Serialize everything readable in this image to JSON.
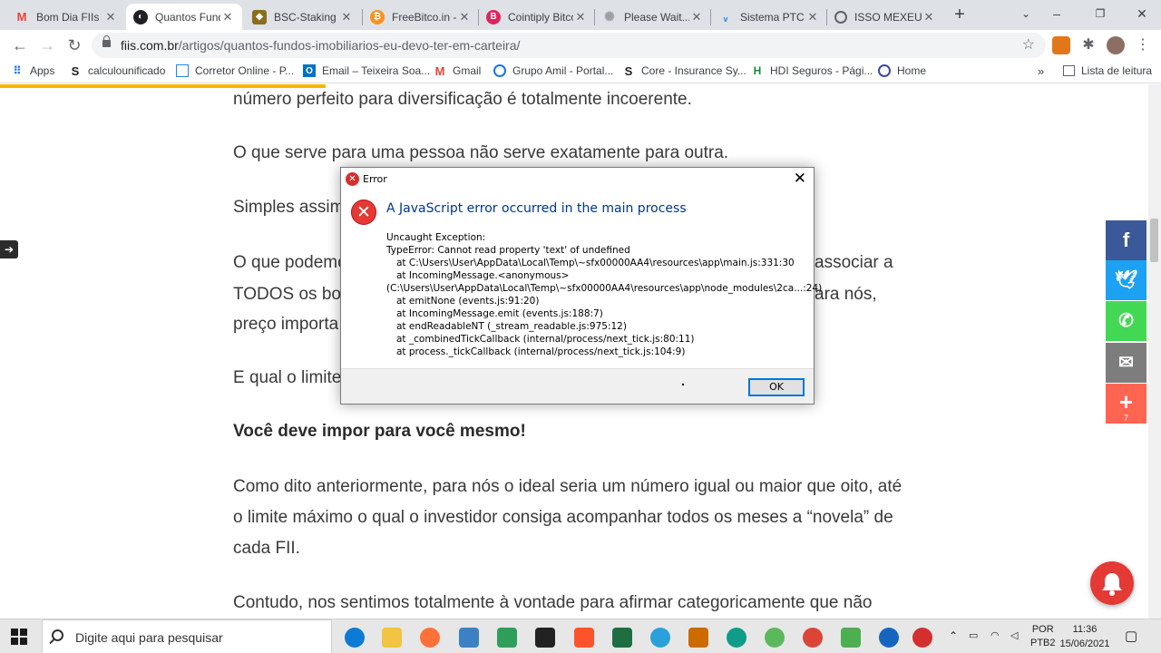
{
  "browser": {
    "tabs": [
      {
        "title": "Bom Dia FIIs",
        "favicon": "gmail-icon",
        "color": "#ea4335"
      },
      {
        "title": "Quantos Fundos",
        "favicon": "fiis-icon",
        "color": "#202124"
      },
      {
        "title": "BSC-Staking",
        "favicon": "bsc-icon",
        "color": "#8a6d1d"
      },
      {
        "title": "FreeBitco.in -",
        "favicon": "bitcoin-icon",
        "color": "#f7931a"
      },
      {
        "title": "Cointiply Bitco",
        "favicon": "cointiply-icon",
        "color": "#e0245e"
      },
      {
        "title": "Please Wait...",
        "favicon": "loading-icon",
        "color": "#9aa0a6"
      },
      {
        "title": "Sistema PTC",
        "favicon": "ptc-icon",
        "color": "#1e88e5"
      },
      {
        "title": "ISSO MEXEU",
        "favicon": "globe-icon",
        "color": "#5f6368"
      }
    ],
    "url_host": "fiis.com.br",
    "url_path": "/artigos/quantos-fundos-imobiliarios-eu-devo-ter-em-carteira/",
    "bookmarks": [
      {
        "label": "Apps",
        "icon": "apps-grid-icon"
      },
      {
        "label": "calculounificado",
        "icon": "s-icon"
      },
      {
        "label": "Corretor Online - P...",
        "icon": "corretor-icon"
      },
      {
        "label": "Email – Teixeira Soa...",
        "icon": "outlook-icon"
      },
      {
        "label": "Gmail",
        "icon": "gmail-icon"
      },
      {
        "label": "Grupo Amil - Portal...",
        "icon": "amil-icon"
      },
      {
        "label": "Core - Insurance Sy...",
        "icon": "core-icon"
      },
      {
        "label": "HDI Seguros - Pági...",
        "icon": "hdi-icon"
      },
      {
        "label": "Home",
        "icon": "home-icon"
      }
    ],
    "reading_list": "Lista de leitura"
  },
  "article": {
    "p1": "número perfeito para diversificação é totalmente incoerente.",
    "p2": "O que serve para uma pessoa não serve exatamente para outra.",
    "p3": "Simples assim",
    "p4a": "O que podemo",
    "p4b": "associar a",
    "p5a": "TODOS os bon",
    "p5b": "ara nós,",
    "p6": "preço importa",
    "p7": "E qual o limite",
    "heading": "Você deve impor para você mesmo!",
    "p8": "Como dito anteriormente, para nós o ideal seria um número igual ou maior que oito, até o limite máximo o qual o investidor consiga acompanhar todos os meses a “novela” de cada FII.",
    "p9": "Contudo, nos sentimos totalmente à vontade para afirmar categoricamente que não",
    "share_count": "7"
  },
  "dialog": {
    "title": "Error",
    "heading": "A JavaScript error occurred in the main process",
    "lines": [
      "Uncaught Exception:",
      "TypeError: Cannot read property 'text' of undefined",
      "at C:\\Users\\User\\AppData\\Local\\Temp\\~sfx00000AA4\\resources\\app\\main.js:331:30",
      "at IncomingMessage.<anonymous>",
      "(C:\\Users\\User\\AppData\\Local\\Temp\\~sfx00000AA4\\resources\\app\\node_modules\\2ca...:24)",
      "at emitNone (events.js:91:20)",
      "at IncomingMessage.emit (events.js:188:7)",
      "at endReadableNT (_stream_readable.js:975:12)",
      "at _combinedTickCallback (internal/process/next_tick.js:80:11)",
      "at process._tickCallback (internal/process/next_tick.js:104:9)"
    ],
    "ok_label": "OK"
  },
  "taskbar": {
    "search_placeholder": "Digite aqui para pesquisar",
    "lang_top": "POR",
    "lang_bottom": "PTB2",
    "time": "11:36",
    "date": "15/06/2021"
  },
  "colors": {
    "facebook": "#3b5998",
    "twitter": "#1da1f2",
    "whatsapp": "#43d854",
    "email": "#7d7d7d",
    "more": "#ff6550",
    "accent_progress": "#f5b800"
  }
}
